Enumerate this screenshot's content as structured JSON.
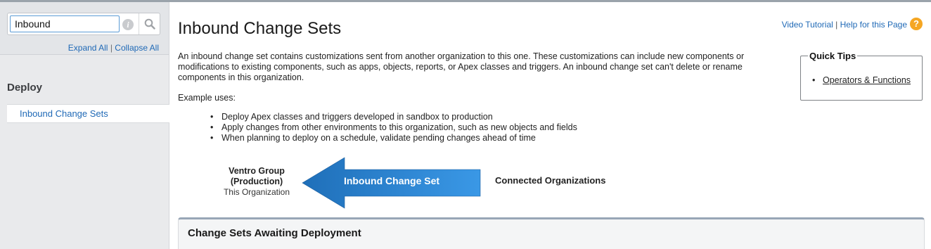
{
  "search": {
    "value": "Inbound",
    "expand_all": "Expand All",
    "separator": "|",
    "collapse_all": "Collapse All"
  },
  "sidebar": {
    "section_heading": "Deploy",
    "items": [
      {
        "label": "Inbound Change Sets"
      }
    ]
  },
  "header": {
    "title": "Inbound Change Sets",
    "video_tutorial": "Video Tutorial",
    "separator": "|",
    "help": "Help for this Page",
    "help_icon_glyph": "?"
  },
  "intro": {
    "text": "An inbound change set contains customizations sent from another organization to this one. These customizations can include new components or modifications to existing components, such as apps, objects, reports, or Apex classes and triggers. An inbound change set can't delete or rename components in this organization.",
    "example_label": "Example uses:",
    "uses": [
      "Deploy Apex classes and triggers developed in sandbox to production",
      "Apply changes from other environments to this organization, such as new objects and fields",
      "When planning to deploy on a schedule, validate pending changes ahead of time"
    ]
  },
  "quick_tips": {
    "title": "Quick Tips",
    "links": [
      "Operators & Functions"
    ]
  },
  "diagram": {
    "org_name": "Ventro Group (Production)",
    "org_sub": "This Organization",
    "arrow_label": "Inbound Change Set",
    "connected": "Connected Organizations",
    "arrow_color_light": "#3a97e6",
    "arrow_color_dark": "#1e6fb8"
  },
  "awaiting": {
    "title": "Change Sets Awaiting Deployment"
  },
  "icons": {
    "info": "info-icon",
    "search": "search-icon",
    "help": "help-icon"
  }
}
